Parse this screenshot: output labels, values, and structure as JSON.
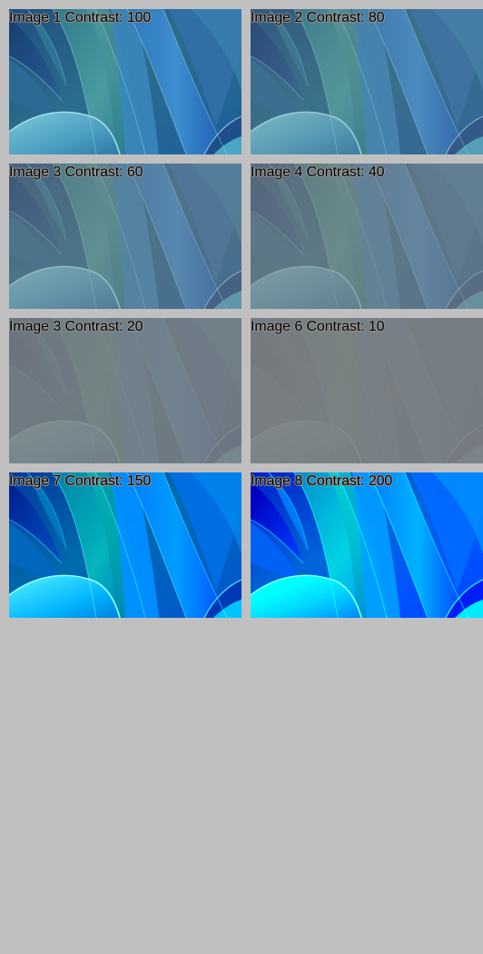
{
  "page": {
    "background": "#c0c0c0"
  },
  "images": [
    {
      "caption": "Image 1 Contrast: 100",
      "contrast": 100
    },
    {
      "caption": "Image 2 Contrast: 80",
      "contrast": 80
    },
    {
      "caption": "Image 3 Contrast: 60",
      "contrast": 60
    },
    {
      "caption": "Image 4 Contrast: 40",
      "contrast": 40
    },
    {
      "caption": "Image 3 Contrast: 20",
      "contrast": 20
    },
    {
      "caption": "Image 6 Contrast: 10",
      "contrast": 10
    },
    {
      "caption": "Image 7 Contrast: 150",
      "contrast": 150
    },
    {
      "caption": "Image 8 Contrast: 200",
      "contrast": 200
    }
  ],
  "colors": {
    "caption_text": "#000000",
    "caption_shadow": "#9a9a9a",
    "leaf_deep_blue": "#143c77",
    "leaf_teal": "#3b8f98",
    "leaf_sky_blue": "#3ba1db",
    "leaf_aqua": "#83d3e1"
  }
}
